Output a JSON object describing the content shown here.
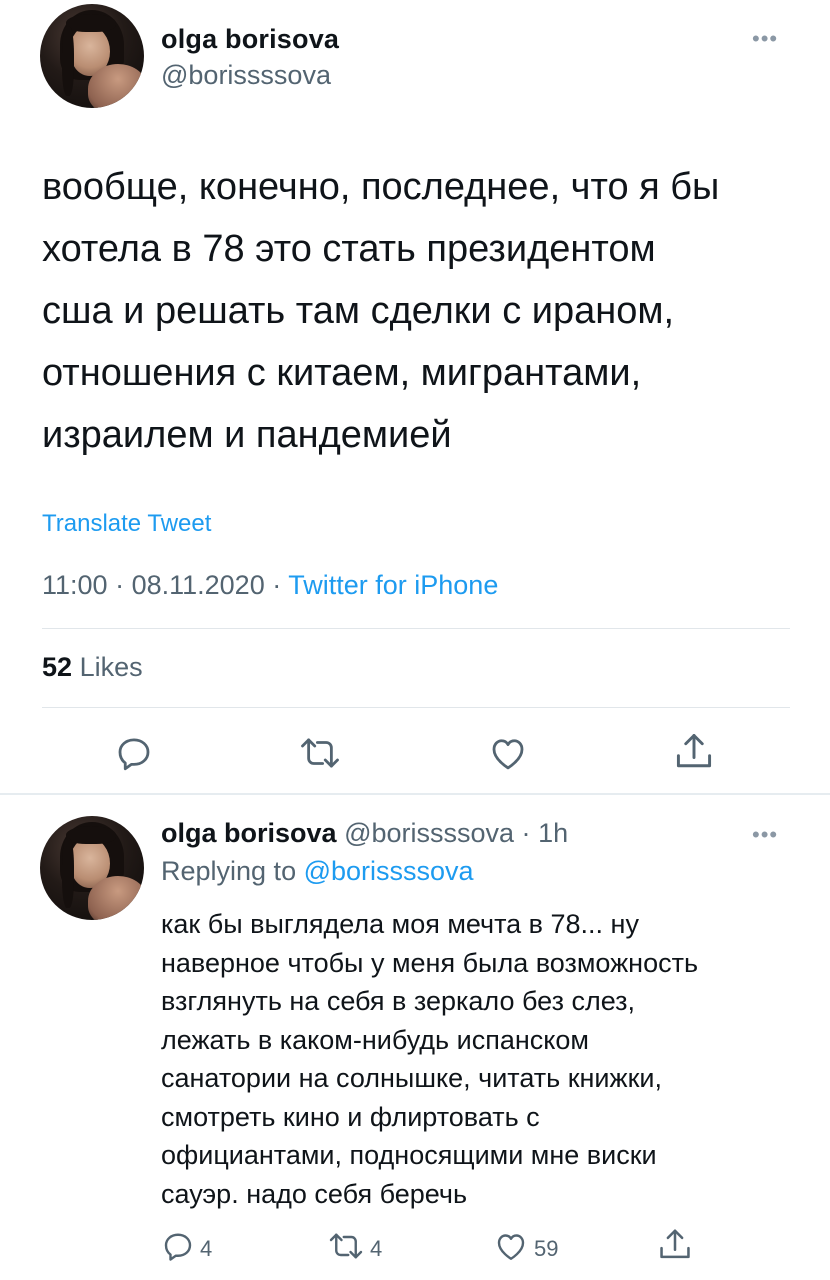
{
  "tweet": {
    "author_name": "olga borisova",
    "author_handle": "@borissssova",
    "text": "вообще, конечно, последнее, что я бы\nхотела в 78 это стать президентом\nсша и решать там сделки с ираном,\nотношения с китаем, мигрантами,\nизраилем и пандемией",
    "translate_label": "Translate Tweet",
    "time": "11:00",
    "date": "08.11.2020",
    "source": "Twitter for iPhone",
    "likes_count": "52",
    "likes_label": "Likes",
    "actions": {
      "reply_icon": "reply-icon",
      "retweet_icon": "retweet-icon",
      "like_icon": "heart-icon",
      "share_icon": "share-icon"
    }
  },
  "reply": {
    "author_name": "olga borisova",
    "author_handle": "@borissssova",
    "age": "1h",
    "replying_prefix": "Replying to",
    "replying_to": "@borissssova",
    "text": "как бы выглядела моя мечта в 78... ну\nнаверное чтобы у меня была возможность\nвзглянуть на себя в зеркало без слез,\nлежать в каком-нибудь испанском\nсанатории на солнышке, читать книжки,\nсмотреть кино и флиртовать с\nофициантами, подносящими мне виски\nсауэр. надо себя беречь",
    "reply_count": "4",
    "retweet_count": "4",
    "like_count": "59"
  },
  "colors": {
    "accent": "#1d9bf0",
    "secondary_text": "#536471",
    "primary_text": "#0f1419",
    "divider": "#e1e6ea"
  }
}
